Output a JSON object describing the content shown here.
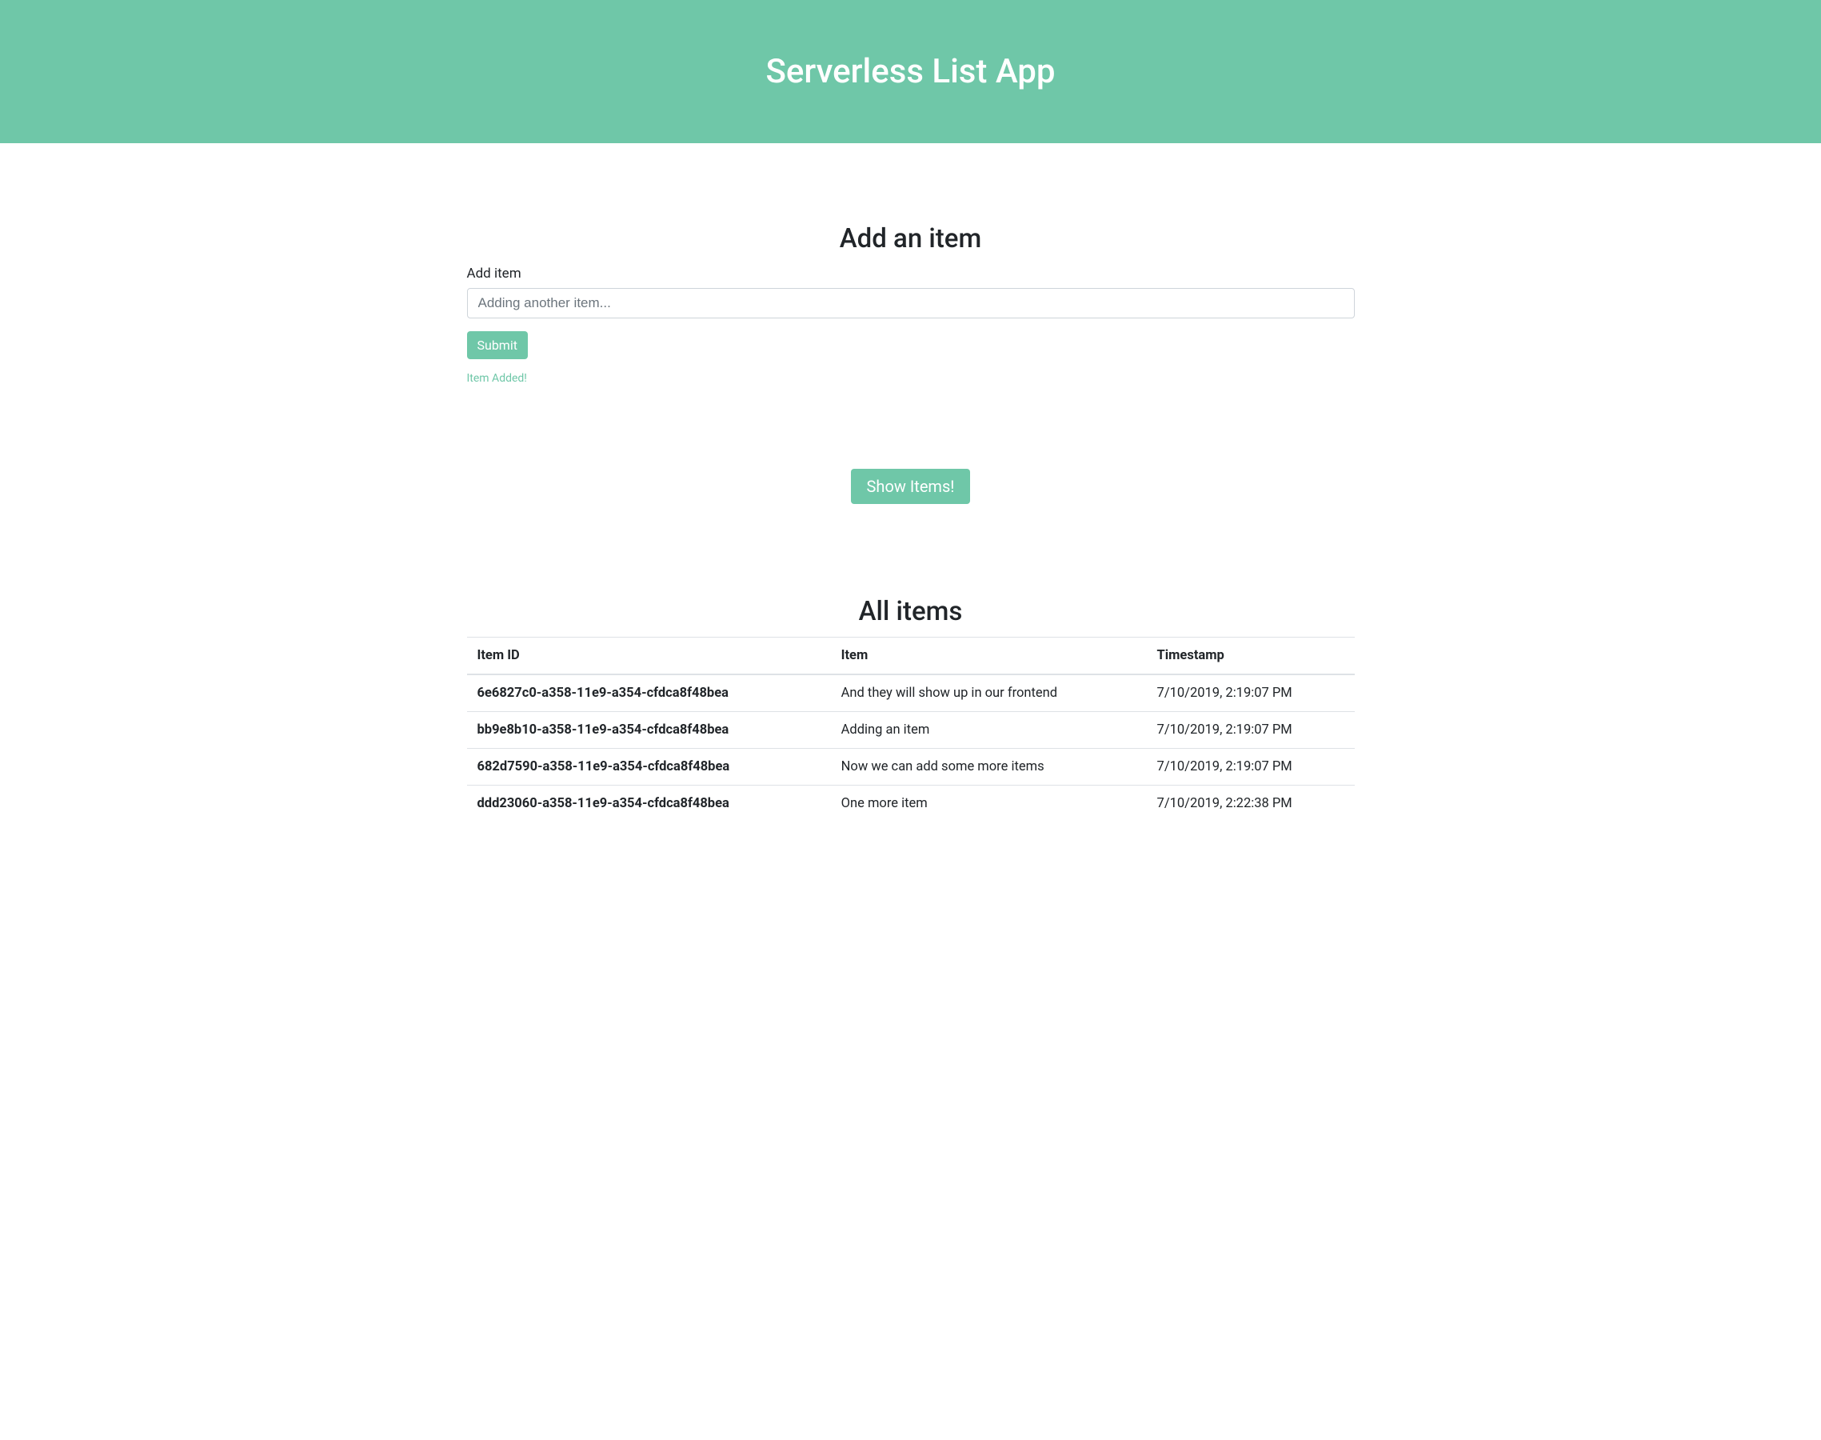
{
  "header": {
    "title": "Serverless List App"
  },
  "add_section": {
    "heading": "Add an item",
    "label": "Add item",
    "placeholder": "Adding another item...",
    "submit_label": "Submit",
    "status_message": "Item Added!"
  },
  "show_section": {
    "button_label": "Show Items!"
  },
  "items_section": {
    "heading": "All items",
    "columns": {
      "id": "Item ID",
      "item": "Item",
      "timestamp": "Timestamp"
    },
    "rows": [
      {
        "id": "6e6827c0-a358-11e9-a354-cfdca8f48bea",
        "item": "And they will show up in our frontend",
        "timestamp": "7/10/2019, 2:19:07 PM"
      },
      {
        "id": "bb9e8b10-a358-11e9-a354-cfdca8f48bea",
        "item": "Adding an item",
        "timestamp": "7/10/2019, 2:19:07 PM"
      },
      {
        "id": "682d7590-a358-11e9-a354-cfdca8f48bea",
        "item": "Now we can add some more items",
        "timestamp": "7/10/2019, 2:19:07 PM"
      },
      {
        "id": "ddd23060-a358-11e9-a354-cfdca8f48bea",
        "item": "One more item",
        "timestamp": "7/10/2019, 2:22:38 PM"
      }
    ]
  }
}
